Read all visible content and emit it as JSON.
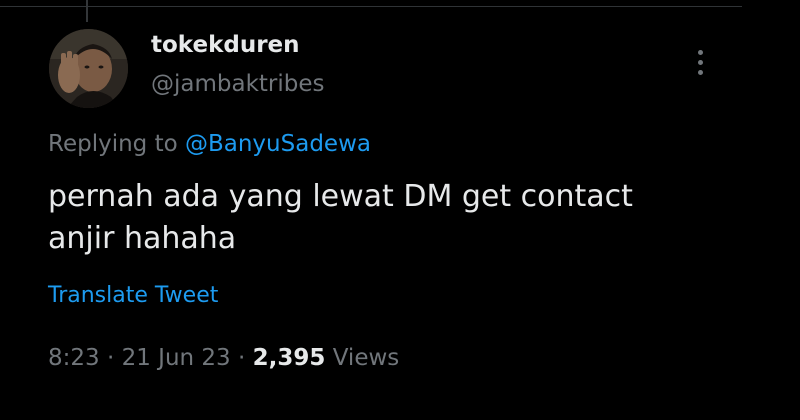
{
  "colors": {
    "background": "#000000",
    "primary_text": "#e7e9ea",
    "secondary_text": "#71767b",
    "link": "#1d9bf0"
  },
  "author": {
    "display_name": "tokekduren",
    "handle": "@jambaktribes",
    "avatar_icon": "user-avatar"
  },
  "more_icon": "vertical-ellipsis-icon",
  "reply": {
    "prefix": "Replying to",
    "mention": "@BanyuSadewa"
  },
  "tweet": {
    "text_line1": "pernah ada yang lewat DM get contact",
    "text_line2": "anjir hahaha"
  },
  "translate_label": "Translate Tweet",
  "meta": {
    "time": "8:23",
    "separator": "·",
    "date": "21 Jun 23",
    "views_count": "2,395",
    "views_label": "Views"
  }
}
